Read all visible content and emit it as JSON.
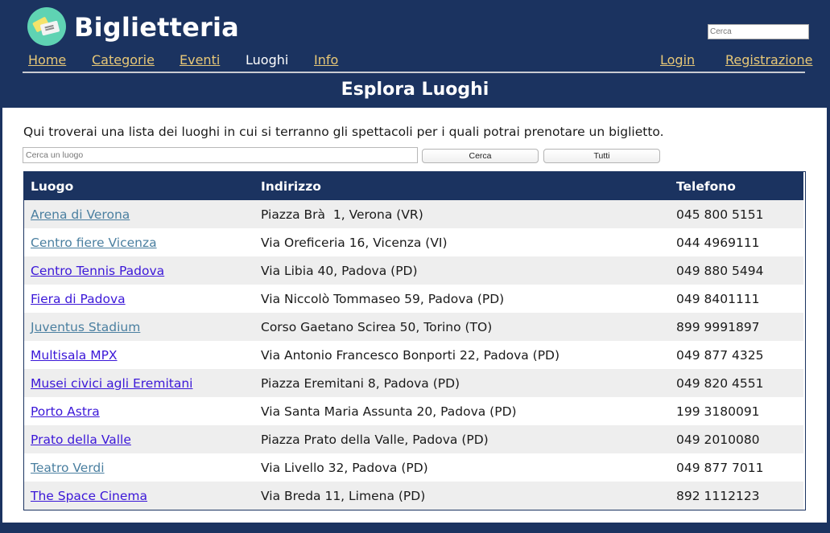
{
  "header": {
    "brand": "Biglietteria",
    "search_placeholder": "Cerca",
    "nav": {
      "home": "Home",
      "categorie": "Categorie",
      "eventi": "Eventi",
      "luoghi": "Luoghi",
      "info": "Info",
      "login": "Login",
      "registrazione": "Registrazione"
    },
    "page_title": "Esplora Luoghi"
  },
  "main": {
    "intro": "Qui troverai una lista dei luoghi in cui si terranno gli spettacoli per i quali potrai prenotare un biglietto.",
    "search_placeholder": "Cerca un luogo",
    "search_button": "Cerca",
    "all_button": "Tutti",
    "table": {
      "headers": [
        "Luogo",
        "Indirizzo",
        "Telefono"
      ],
      "rows": [
        {
          "luogo": "Arena di Verona",
          "indirizzo": "Piazza Brà  1, Verona (VR)",
          "telefono": "045 800 5151"
        },
        {
          "luogo": "Centro fiere Vicenza",
          "indirizzo": "Via Oreficeria 16, Vicenza (VI)",
          "telefono": "044 4969111"
        },
        {
          "luogo": "Centro Tennis Padova",
          "indirizzo": "Via Libia 40, Padova (PD)",
          "telefono": "049 880 5494"
        },
        {
          "luogo": "Fiera di Padova",
          "indirizzo": "Via Niccolò Tommaseo 59, Padova (PD)",
          "telefono": "049 8401111"
        },
        {
          "luogo": "Juventus Stadium",
          "indirizzo": "Corso Gaetano Scirea 50, Torino (TO)",
          "telefono": "899 9991897"
        },
        {
          "luogo": "Multisala MPX",
          "indirizzo": "Via Antonio Francesco Bonporti 22, Padova (PD)",
          "telefono": "049 877 4325"
        },
        {
          "luogo": "Musei civici agli Eremitani",
          "indirizzo": "Piazza Eremitani 8, Padova (PD)",
          "telefono": "049 820 4551"
        },
        {
          "luogo": "Porto Astra",
          "indirizzo": "Via Santa Maria Assunta 20, Padova (PD)",
          "telefono": "199 3180091"
        },
        {
          "luogo": "Prato della Valle",
          "indirizzo": "Piazza Prato della Valle, Padova (PD)",
          "telefono": "049 2010080"
        },
        {
          "luogo": "Teatro Verdi",
          "indirizzo": "Via Livello 32, Padova (PD)",
          "telefono": "049 877 7011"
        },
        {
          "luogo": "The Space Cinema",
          "indirizzo": "Via Breda 11, Limena (PD)",
          "telefono": "892 1112123"
        }
      ]
    }
  },
  "colors": {
    "header_bg": "#1b3360",
    "nav_link": "#e8c877",
    "link": "#3b17d8",
    "visited_link": "#4a7fa0",
    "row_alt": "#eeeeee"
  },
  "icons": {
    "logo": "ticket-logo-icon"
  }
}
